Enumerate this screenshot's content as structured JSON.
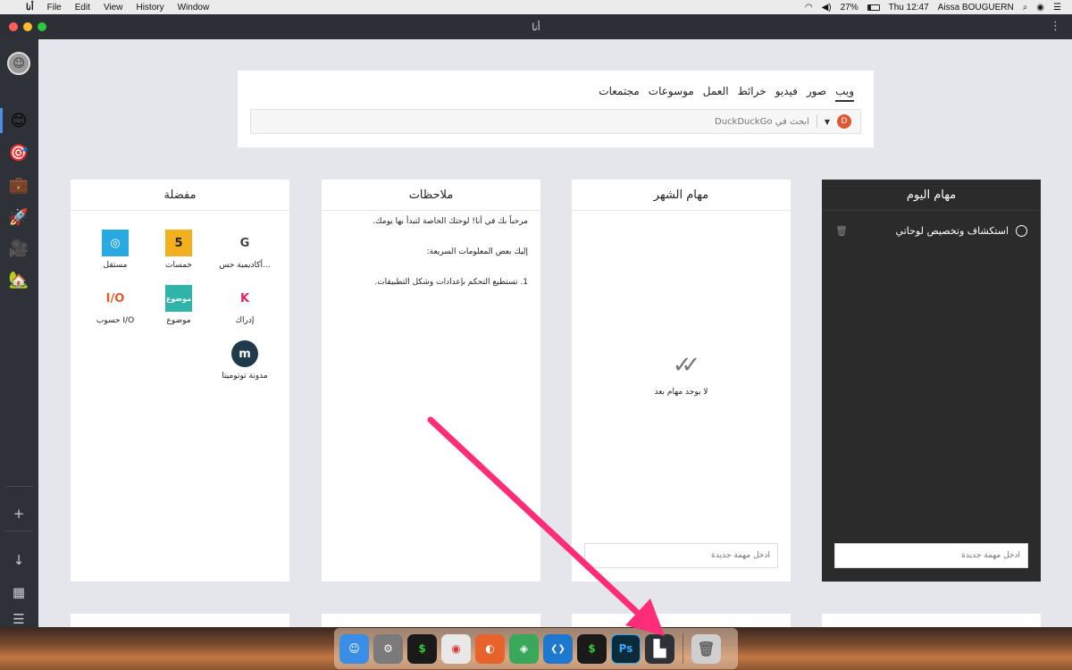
{
  "menubar": {
    "apple": "",
    "app_name": "أنا",
    "menus": [
      "File",
      "Edit",
      "View",
      "History",
      "Window"
    ],
    "battery": "27%",
    "clock": "Thu 12:47",
    "user": "Aissa BOUGUERN"
  },
  "window": {
    "title": "أنا"
  },
  "sidebar": {
    "items": [
      {
        "name": "avatar",
        "glyph": "☺"
      },
      {
        "name": "smiley",
        "glyph": "😊"
      },
      {
        "name": "target",
        "glyph": "🎯"
      },
      {
        "name": "briefcase",
        "glyph": "💼"
      },
      {
        "name": "rocket",
        "glyph": "🚀"
      },
      {
        "name": "film",
        "glyph": "🎥"
      },
      {
        "name": "house",
        "glyph": "🏡"
      }
    ],
    "controls": [
      "+",
      "↓",
      "▦",
      "☰"
    ]
  },
  "search": {
    "tabs": [
      "ويب",
      "صور",
      "فيديو",
      "خرائط",
      "العمل",
      "موسوعات",
      "مجتمعات"
    ],
    "active_tab": "ويب",
    "placeholder": "ابحث في DuckDuckGo",
    "engine_icon": "duckduckgo-icon"
  },
  "panels": {
    "today": {
      "title": "مهام اليوم",
      "task": "استكشاف وتخصيص لوحاتي",
      "input_placeholder": "أدخل مهمة جديدة"
    },
    "month": {
      "title": "مهام الشهر",
      "empty_msg": "لا يوجد مهام بعد",
      "input_placeholder": "أدخل مهمة جديدة"
    },
    "notes": {
      "title": "ملاحظات",
      "lines": [
        "مرحباً بك في أنا! لوحتك الخاصة لتبدأ بها يومك.",
        "إليك بعض المعلومات السريعة:",
        "1. تستطيع التحكم بإعدادات وشكل التطبيقات."
      ]
    },
    "favorites": {
      "title": "مفضلة",
      "items": [
        {
          "label": "أكاديمية حس...",
          "logo": "G",
          "color": "#444444"
        },
        {
          "label": "خمسات",
          "logo": "5",
          "color": "#f2b01e"
        },
        {
          "label": "مستقل",
          "logo": "◎",
          "color": "#28a9e0"
        },
        {
          "label": "إدراك",
          "logo": "K",
          "color": "#e0245e"
        },
        {
          "label": "موضوع",
          "logo": "موضوع",
          "color": "#2db5a9"
        },
        {
          "label": "حسوب I/O",
          "logo": "I/O",
          "color": "#e05b2a"
        },
        {
          "label": "مدونة توتوميتا",
          "logo": "m",
          "color": "#1f3a4a"
        }
      ]
    }
  },
  "dock": {
    "apps": [
      {
        "name": "finder-icon",
        "glyph": "☺",
        "color": "#3a8ee6"
      },
      {
        "name": "system-preferences-icon",
        "glyph": "⚙",
        "color": "#7a7a7a"
      },
      {
        "name": "terminal-icon",
        "glyph": "$",
        "color": "#1a1a1a"
      },
      {
        "name": "chrome-icon",
        "glyph": "◉",
        "color": "#e8e8e8"
      },
      {
        "name": "firefox-icon",
        "glyph": "◐",
        "color": "#e8622c"
      },
      {
        "name": "app-green-icon",
        "glyph": "◈",
        "color": "#3aa85a"
      },
      {
        "name": "vscode-icon",
        "glyph": "❮❯",
        "color": "#1e78d0"
      },
      {
        "name": "terminal-2-icon",
        "glyph": "$",
        "color": "#1a1a1a"
      },
      {
        "name": "photoshop-icon",
        "glyph": "Ps",
        "color": "#0b2a3a"
      },
      {
        "name": "ana-app-icon",
        "glyph": "▙",
        "color": "#2e3238"
      },
      {
        "name": "trash-icon",
        "glyph": "🗑",
        "color": "#cfcfcf"
      }
    ]
  },
  "colors": {
    "window_bg": "#e4e6ec",
    "sidebar_bg": "#2e3238",
    "today_bg": "#2b2b2b",
    "arrow": "#ff2d78"
  }
}
